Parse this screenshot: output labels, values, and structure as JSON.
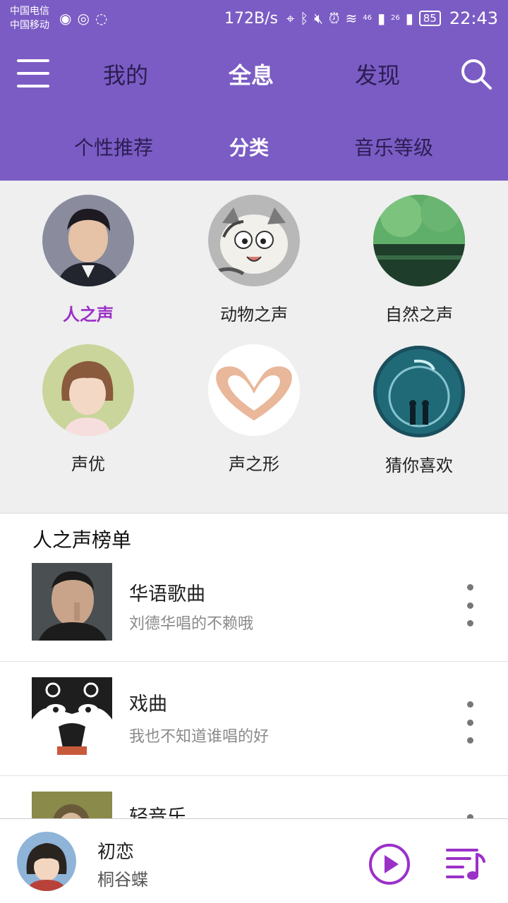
{
  "status_bar": {
    "carrier_1": "中国电信",
    "carrier_2": "中国移动",
    "network_speed": "172B/s",
    "signal_1_label": "46",
    "signal_2_label": "26",
    "battery": "85",
    "time": "22:43"
  },
  "nav": {
    "tabs": [
      {
        "label": "我的",
        "active": false
      },
      {
        "label": "全息",
        "active": true
      },
      {
        "label": "发现",
        "active": false
      }
    ]
  },
  "sub_nav": {
    "tabs": [
      {
        "label": "个性推荐",
        "active": false
      },
      {
        "label": "分类",
        "active": true
      },
      {
        "label": "音乐等级",
        "active": false
      }
    ]
  },
  "categories": [
    {
      "label": "人之声",
      "active": true
    },
    {
      "label": "动物之声",
      "active": false
    },
    {
      "label": "自然之声",
      "active": false
    },
    {
      "label": "声优",
      "active": false
    },
    {
      "label": "声之形",
      "active": false
    },
    {
      "label": "猜你喜欢",
      "active": false
    }
  ],
  "chart": {
    "title": "人之声榜单",
    "items": [
      {
        "title": "华语歌曲",
        "subtitle": "刘德华唱的不赖哦"
      },
      {
        "title": "戏曲",
        "subtitle": "我也不知道谁唱的好"
      },
      {
        "title": "轻音乐",
        "subtitle": ""
      }
    ]
  },
  "player": {
    "song": "初恋",
    "artist": "桐谷蝶"
  },
  "colors": {
    "header": "#7b5cc4",
    "accent": "#9b30c8",
    "category_bg": "#efefef"
  }
}
